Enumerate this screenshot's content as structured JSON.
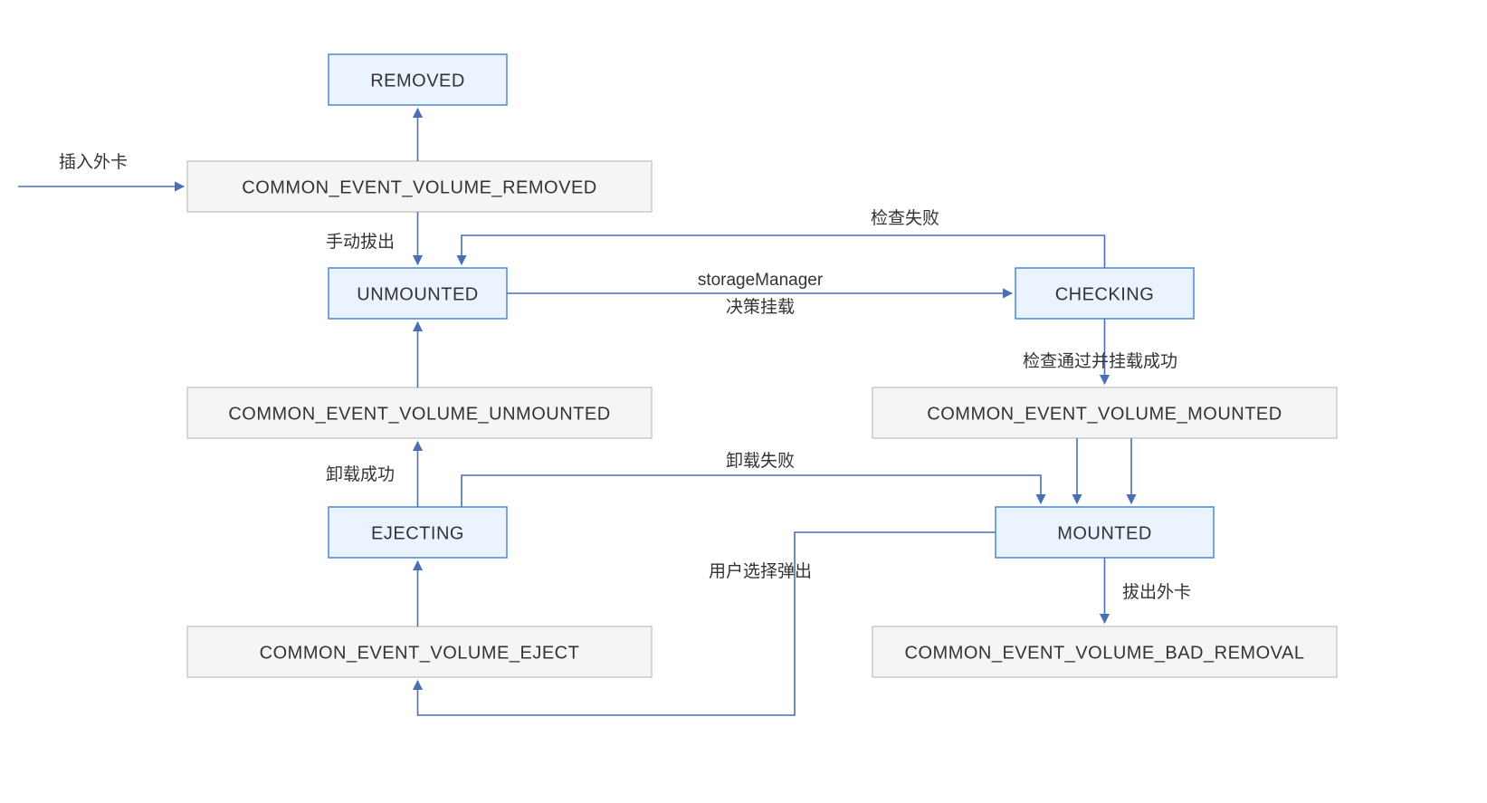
{
  "states": {
    "removed": "REMOVED",
    "unmounted": "UNMOUNTED",
    "checking": "CHECKING",
    "ejecting": "EJECTING",
    "mounted": "MOUNTED"
  },
  "events": {
    "volume_removed": "COMMON_EVENT_VOLUME_REMOVED",
    "volume_unmounted": "COMMON_EVENT_VOLUME_UNMOUNTED",
    "volume_mounted": "COMMON_EVENT_VOLUME_MOUNTED",
    "volume_eject": "COMMON_EVENT_VOLUME_EJECT",
    "volume_bad_removal": "COMMON_EVENT_VOLUME_BAD_REMOVAL"
  },
  "labels": {
    "insert_card": "插入外卡",
    "manual_pull": "手动拔出",
    "check_fail": "检查失败",
    "storage_manager": "storageManager",
    "decide_mount": "决策挂载",
    "check_pass_mount_ok": "检查通过并挂载成功",
    "unload_success": "卸载成功",
    "unload_fail": "卸载失败",
    "user_choose_eject": "用户选择弹出",
    "pull_card": "拔出外卡"
  }
}
